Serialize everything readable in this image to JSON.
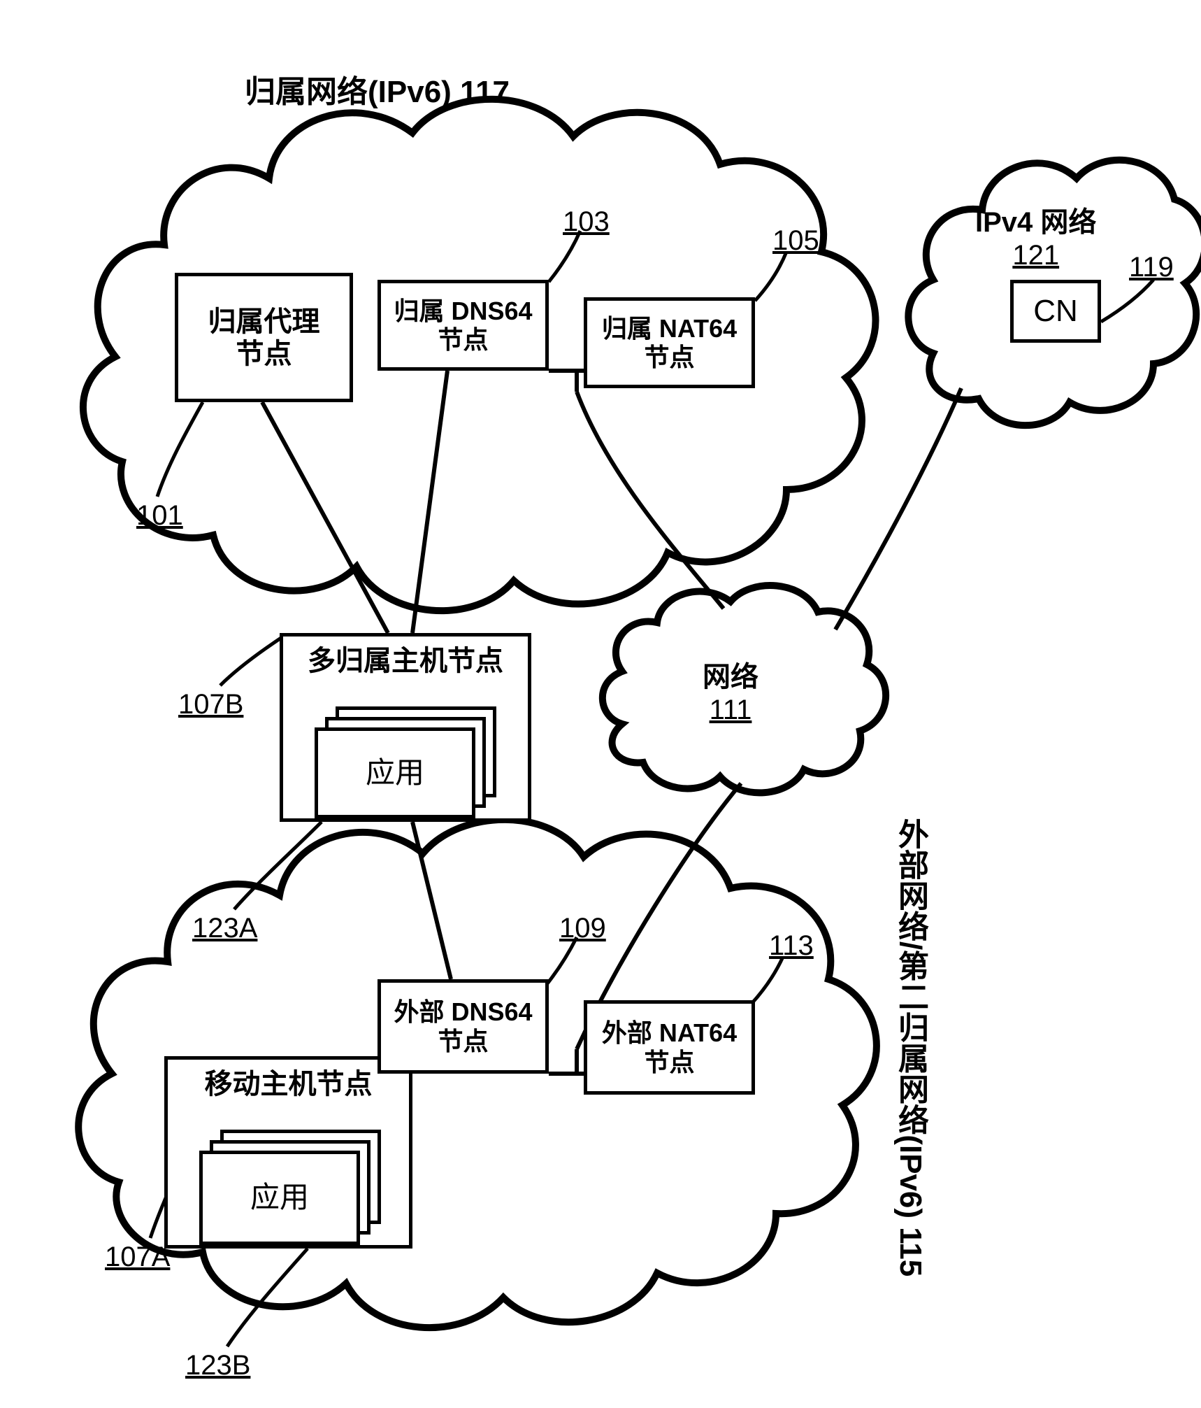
{
  "labels": {
    "home_network": "归属网络(IPv6) 117",
    "foreign_network": "外部网络/第二归属网络(IPv6) 115",
    "ipv4_network_title": "IPv4 网络",
    "ipv4_network_ref": "121",
    "cn": "CN",
    "cn_ref": "119",
    "network_cloud": "网络",
    "network_cloud_ref": "111"
  },
  "nodes": {
    "home_agent": {
      "l1": "归属代理",
      "l2": "节点",
      "ref": "101"
    },
    "home_dns64": {
      "l1": "归属 DNS64",
      "l2": "节点",
      "ref": "103"
    },
    "home_nat64": {
      "l1": "归属 NAT64",
      "l2": "节点",
      "ref": "105"
    },
    "foreign_dns64": {
      "l1": "外部 DNS64",
      "l2": "节点",
      "ref": "109"
    },
    "foreign_nat64": {
      "l1": "外部 NAT64",
      "l2": "节点",
      "ref": "113"
    },
    "multihomed": {
      "title": "多归属主机节点",
      "ref": "107B"
    },
    "mobile": {
      "title": "移动主机节点",
      "ref": "107A"
    },
    "app": "应用",
    "app_ref_a": "123A",
    "app_ref_b": "123B"
  }
}
